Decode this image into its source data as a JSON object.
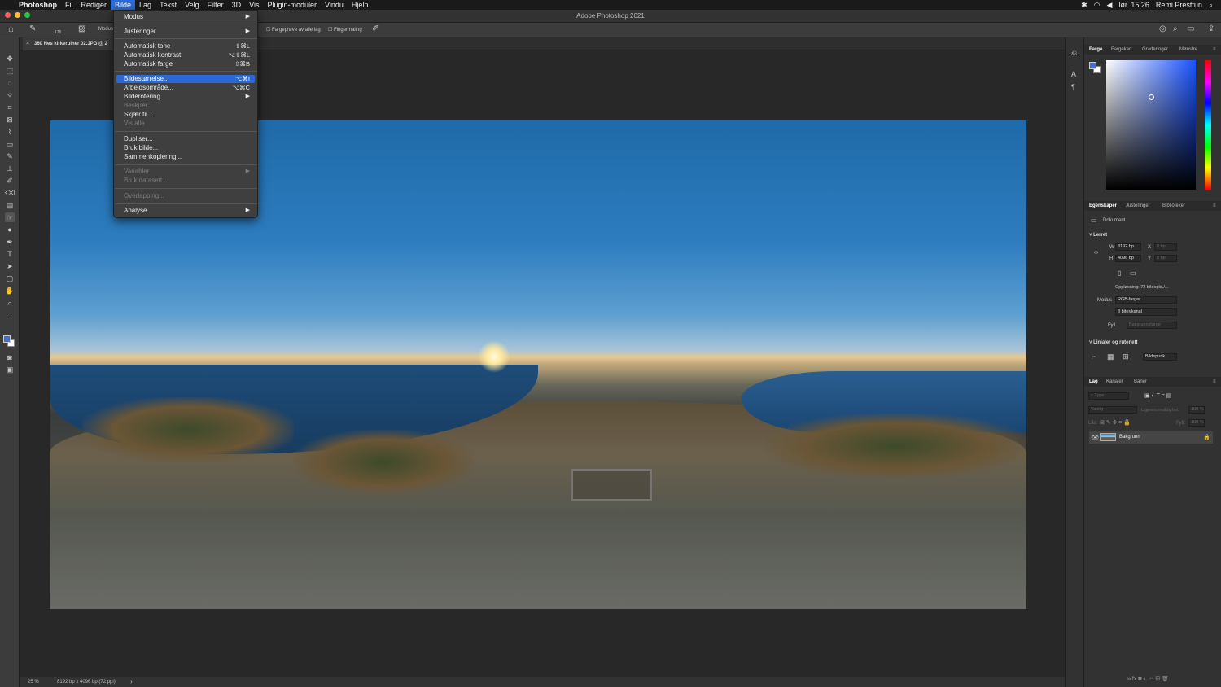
{
  "menubar": {
    "app": "Photoshop",
    "items": [
      "Fil",
      "Rediger",
      "Bilde",
      "Lag",
      "Tekst",
      "Velg",
      "Filter",
      "3D",
      "Vis",
      "Plugin-moduler",
      "Vindu",
      "Hjelp"
    ],
    "active": "Bilde",
    "clock": "lør. 15:26",
    "user": "Remi Presttun"
  },
  "window": {
    "title": "Adobe Photoshop 2021"
  },
  "options": {
    "size": "175",
    "mode": "Modus",
    "sample_all": "Fargeprøve av alle lag",
    "finger": "Fingermaling"
  },
  "document": {
    "tab_title": "360 Nes kirkeruiner 02.JPG @ 2"
  },
  "bilde_menu": {
    "items": [
      {
        "label": "Modus",
        "shortcut": "",
        "submenu": true,
        "disabled": false,
        "highlight": false
      },
      {
        "label": "Justeringer",
        "shortcut": "",
        "submenu": true,
        "disabled": false,
        "highlight": false
      },
      {
        "label": "Automatisk tone",
        "shortcut": "⇧⌘L",
        "submenu": false,
        "disabled": false,
        "highlight": false
      },
      {
        "label": "Automatisk kontrast",
        "shortcut": "⌥⇧⌘L",
        "submenu": false,
        "disabled": false,
        "highlight": false
      },
      {
        "label": "Automatisk farge",
        "shortcut": "⇧⌘B",
        "submenu": false,
        "disabled": false,
        "highlight": false
      },
      {
        "label": "Bildestørrelse...",
        "shortcut": "⌥⌘I",
        "submenu": false,
        "disabled": false,
        "highlight": true
      },
      {
        "label": "Arbeidsområde...",
        "shortcut": "⌥⌘C",
        "submenu": false,
        "disabled": false,
        "highlight": false
      },
      {
        "label": "Bilderotering",
        "shortcut": "",
        "submenu": true,
        "disabled": false,
        "highlight": false
      },
      {
        "label": "Beskjær",
        "shortcut": "",
        "submenu": false,
        "disabled": true,
        "highlight": false
      },
      {
        "label": "Skjær til...",
        "shortcut": "",
        "submenu": false,
        "disabled": false,
        "highlight": false
      },
      {
        "label": "Vis alle",
        "shortcut": "",
        "submenu": false,
        "disabled": true,
        "highlight": false
      },
      {
        "label": "Dupliser...",
        "shortcut": "",
        "submenu": false,
        "disabled": false,
        "highlight": false
      },
      {
        "label": "Bruk bilde...",
        "shortcut": "",
        "submenu": false,
        "disabled": false,
        "highlight": false
      },
      {
        "label": "Sammenkopiering...",
        "shortcut": "",
        "submenu": false,
        "disabled": false,
        "highlight": false
      },
      {
        "label": "Variabler",
        "shortcut": "",
        "submenu": true,
        "disabled": true,
        "highlight": false
      },
      {
        "label": "Bruk datasett...",
        "shortcut": "",
        "submenu": false,
        "disabled": true,
        "highlight": false
      },
      {
        "label": "Overlapping...",
        "shortcut": "",
        "submenu": false,
        "disabled": true,
        "highlight": false
      },
      {
        "label": "Analyse",
        "shortcut": "",
        "submenu": true,
        "disabled": false,
        "highlight": false
      }
    ]
  },
  "status": {
    "zoom": "25 %",
    "info": "8192 bp x 4096 bp (72 ppi)"
  },
  "color_panel": {
    "tabs": [
      "Farge",
      "Fargekart",
      "Graderinger",
      "Mønstre"
    ]
  },
  "properties_panel": {
    "tabs": [
      "Egenskaper",
      "Justeringer",
      "Biblioteker"
    ],
    "doc_label": "Dokument",
    "canvas_section": "Lerret",
    "w_label": "W",
    "w_value": "8192 bp",
    "h_label": "H",
    "h_value": "4096 bp",
    "x_label": "X",
    "x_value": "0 bp",
    "y_label": "Y",
    "y_value": "0 bp",
    "resolution": "Oppløsning: 72 bildepkt./...",
    "mode_label": "Modus",
    "mode_value": "RGB-farger",
    "bits_value": "8 biter/kanal",
    "fill_label": "Fyll",
    "fill_value": "Bakgrunnsfarge",
    "rulers_section": "Linjaler og rutenett",
    "units_value": "Bildepunk..."
  },
  "layers_panel": {
    "tabs": [
      "Lag",
      "Kanaler",
      "Baner"
    ],
    "search_placeholder": "Type",
    "blend_mode": "Vanlig",
    "opacity_label": "Ugjennomsiktighet:",
    "opacity_value": "100 %",
    "lock_label": "Lås:",
    "fill_label": "Fyll:",
    "fill_value": "100 %",
    "layer_name": "Bakgrunn"
  },
  "colors": {
    "accent": "#2a6ad8",
    "foreground": "#3f6fd8",
    "background": "#ffffff"
  }
}
